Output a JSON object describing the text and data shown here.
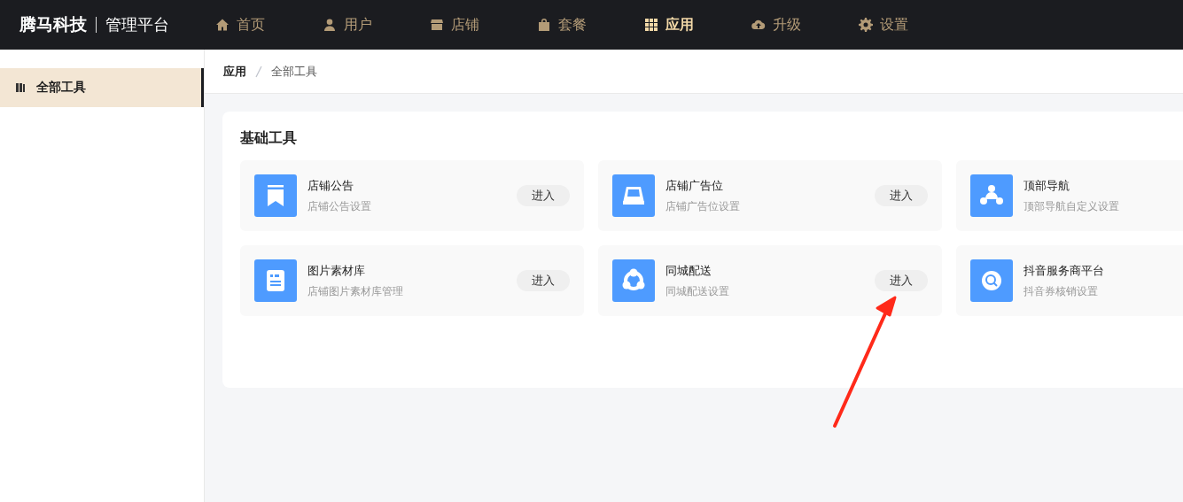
{
  "brand": {
    "name": "腾马科技",
    "subtitle": "管理平台"
  },
  "nav": [
    {
      "label": "首页",
      "kind": "home",
      "selected": false
    },
    {
      "label": "用户",
      "kind": "user",
      "selected": false
    },
    {
      "label": "店铺",
      "kind": "shop",
      "selected": false
    },
    {
      "label": "套餐",
      "kind": "bag",
      "selected": false
    },
    {
      "label": "应用",
      "kind": "grid",
      "selected": true
    },
    {
      "label": "升级",
      "kind": "cloud",
      "selected": false
    },
    {
      "label": "设置",
      "kind": "gear",
      "selected": false
    }
  ],
  "sidebar": {
    "items": [
      {
        "label": "全部工具",
        "selected": true
      }
    ]
  },
  "breadcrumb": [
    "应用",
    "全部工具"
  ],
  "section": {
    "title": "基础工具",
    "tools": [
      {
        "title": "店铺公告",
        "subtitle": "店铺公告设置",
        "kind": "bookmark",
        "button": "进入"
      },
      {
        "title": "店铺广告位",
        "subtitle": "店铺广告位设置",
        "kind": "tray",
        "button": "进入"
      },
      {
        "title": "顶部导航",
        "subtitle": "顶部导航自定义设置",
        "kind": "people"
      },
      {
        "title": "图片素材库",
        "subtitle": "店铺图片素材库管理",
        "kind": "doc",
        "button": "进入"
      },
      {
        "title": "同城配送",
        "subtitle": "同城配送设置",
        "kind": "share",
        "button": "进入"
      },
      {
        "title": "抖音服务商平台",
        "subtitle": "抖音券核销设置",
        "kind": "scan"
      }
    ]
  },
  "annotation": {
    "kind": "arrow"
  }
}
